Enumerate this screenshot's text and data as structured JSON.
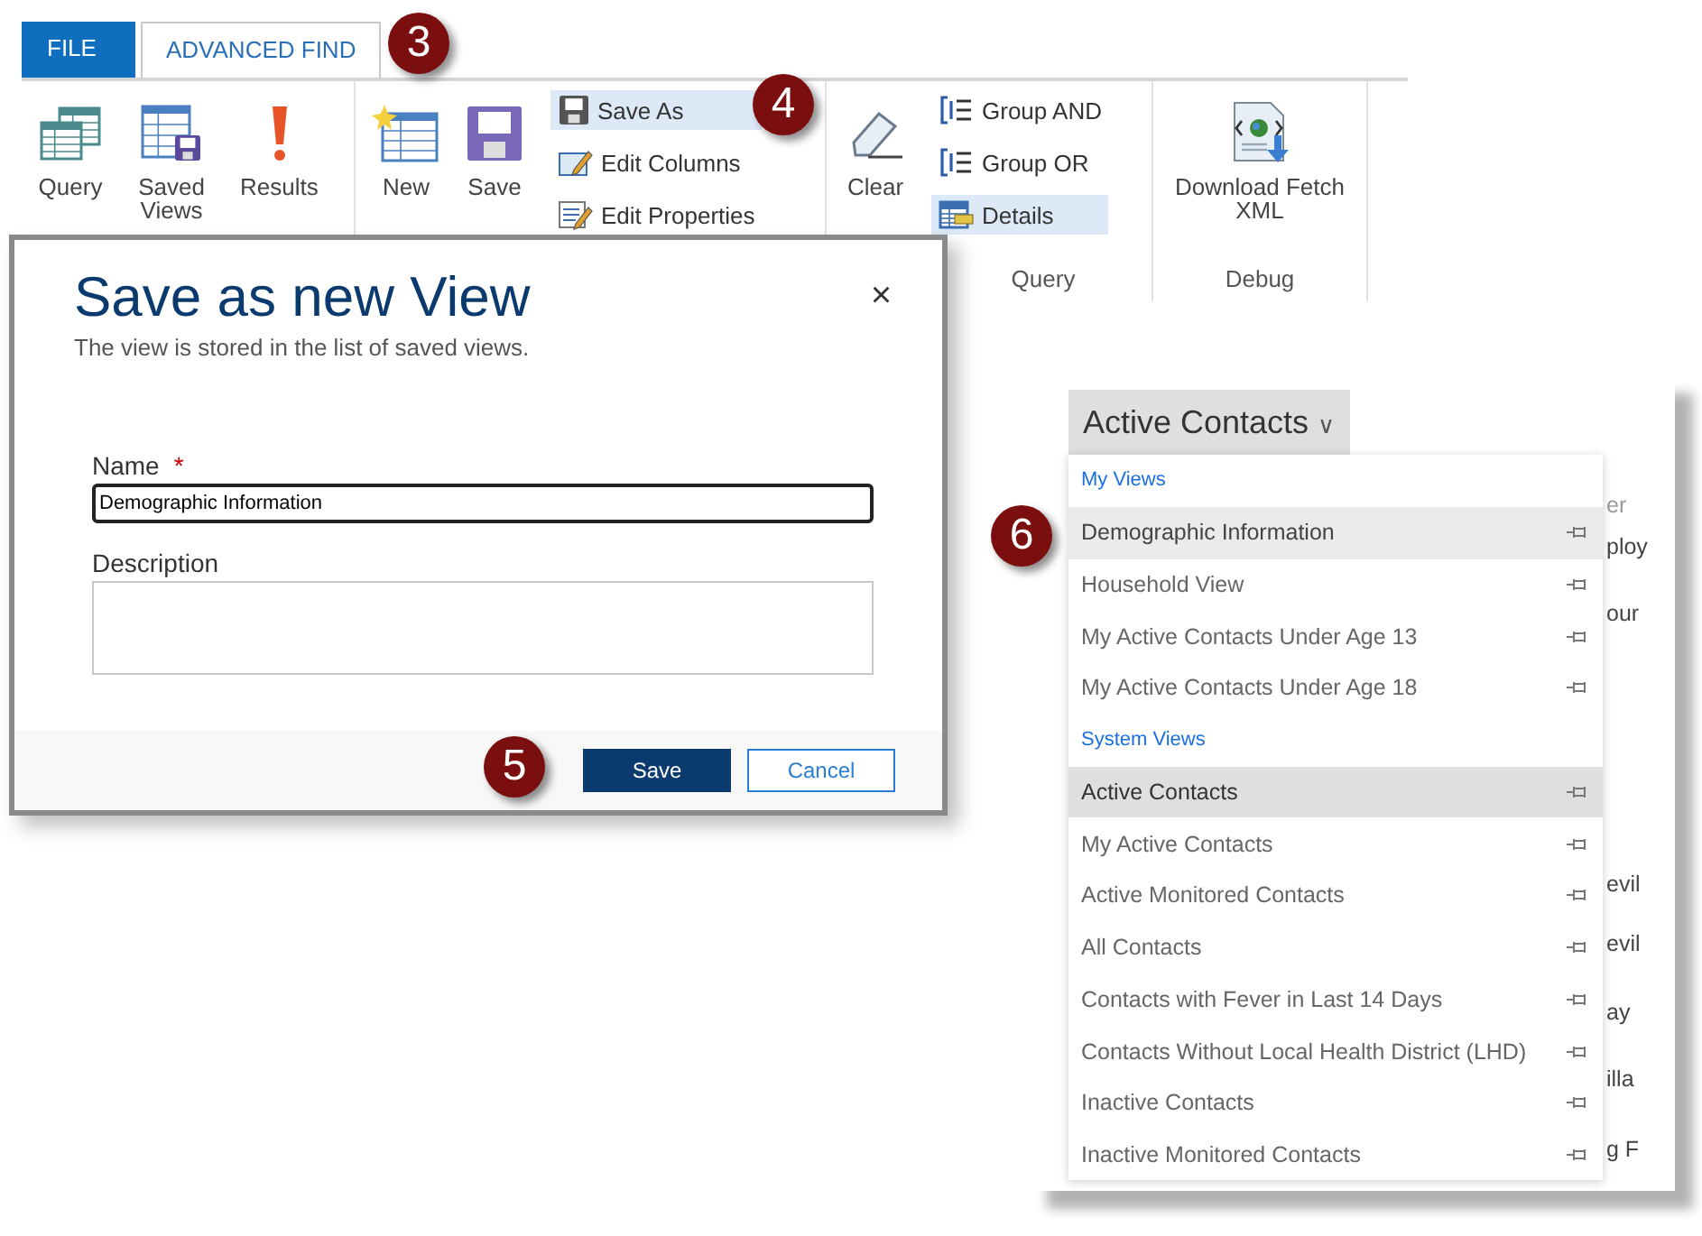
{
  "ribbon": {
    "tabs": [
      {
        "label": "FILE",
        "kind": "file",
        "selected": false
      },
      {
        "label": "ADVANCED FIND",
        "kind": "tab",
        "selected": true
      }
    ],
    "groups": [
      {
        "items": [
          {
            "label": "Query",
            "kind": "large",
            "highlighted": false
          },
          {
            "label": "Saved Views",
            "kind": "large",
            "highlighted": false
          },
          {
            "label": "Results",
            "kind": "large",
            "highlighted": false
          }
        ]
      },
      {
        "items": [
          {
            "label": "New",
            "kind": "large",
            "highlighted": false
          },
          {
            "label": "Save",
            "kind": "large",
            "highlighted": false
          },
          {
            "label": "Save As",
            "kind": "small",
            "highlighted": true
          },
          {
            "label": "Edit Columns",
            "kind": "small",
            "highlighted": false
          },
          {
            "label": "Edit Properties",
            "kind": "small",
            "highlighted": false
          }
        ]
      },
      {
        "label": "Query",
        "items": [
          {
            "label": "Clear",
            "kind": "large",
            "highlighted": false
          },
          {
            "label": "Group AND",
            "kind": "small",
            "highlighted": false
          },
          {
            "label": "Group OR",
            "kind": "small",
            "highlighted": false
          },
          {
            "label": "Details",
            "kind": "small",
            "highlighted": true
          }
        ]
      },
      {
        "label": "Debug",
        "items": [
          {
            "label": "Download Fetch XML",
            "kind": "large",
            "highlighted": false
          }
        ]
      }
    ]
  },
  "dialog": {
    "title": "Save as new View",
    "subtitle": "The view is stored in the list of saved views.",
    "close": "×",
    "fields": [
      {
        "label": "Name",
        "required_mark": "*",
        "kind": "input",
        "value": "Demographic Information"
      },
      {
        "label": "Description",
        "kind": "textarea"
      }
    ],
    "buttons": [
      {
        "label": "Save",
        "kind": "primary"
      },
      {
        "label": "Cancel",
        "kind": "secondary"
      }
    ]
  },
  "views_panel": {
    "selector": {
      "label": "Active Contacts",
      "caret": "∨"
    },
    "sections": [
      {
        "header": "My Views",
        "items": [
          {
            "label": "Demographic Information",
            "selected": false,
            "hovered": true
          },
          {
            "label": "Household View",
            "selected": false,
            "hovered": false
          },
          {
            "label": "My Active Contacts Under Age 13",
            "selected": false,
            "hovered": false
          },
          {
            "label": "My Active Contacts Under Age 18",
            "selected": false,
            "hovered": false
          }
        ]
      },
      {
        "header": "System Views",
        "items": [
          {
            "label": "Active Contacts",
            "selected": true,
            "hovered": false
          },
          {
            "label": "My Active Contacts",
            "selected": false,
            "hovered": false
          },
          {
            "label": "Active Monitored Contacts",
            "selected": false,
            "hovered": false
          },
          {
            "label": "All Contacts",
            "selected": false,
            "hovered": false
          },
          {
            "label": "Contacts with Fever in Last 14 Days",
            "selected": false,
            "hovered": false
          },
          {
            "label": "Contacts Without Local Health District (LHD)",
            "selected": false,
            "hovered": false
          },
          {
            "label": "Inactive Contacts",
            "selected": false,
            "hovered": false
          },
          {
            "label": "Inactive Monitored Contacts",
            "selected": false,
            "hovered": false
          }
        ]
      }
    ],
    "grid_fragments": [
      "er",
      "ploy",
      "our",
      "evil",
      "evil",
      "ay",
      "illa",
      "g F"
    ]
  },
  "callouts": [
    {
      "number": "3"
    },
    {
      "number": "4"
    },
    {
      "number": "5"
    },
    {
      "number": "6"
    }
  ]
}
